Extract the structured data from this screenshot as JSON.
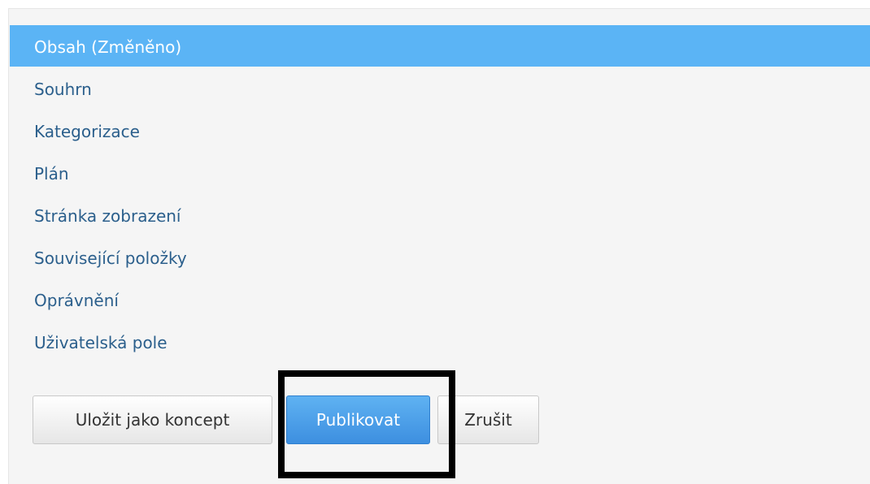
{
  "tabs": [
    {
      "label": "Obsah (Změněno)",
      "active": true
    },
    {
      "label": "Souhrn",
      "active": false
    },
    {
      "label": "Kategorizace",
      "active": false
    },
    {
      "label": "Plán",
      "active": false
    },
    {
      "label": "Stránka zobrazení",
      "active": false
    },
    {
      "label": "Související položky",
      "active": false
    },
    {
      "label": "Oprávnění",
      "active": false
    },
    {
      "label": "Uživatelská pole",
      "active": false
    }
  ],
  "actions": {
    "save_draft_label": "Uložit jako koncept",
    "publish_label": "Publikovat",
    "cancel_label": "Zrušit"
  },
  "colors": {
    "active_tab": "#5bb4f5",
    "link": "#2b5f8c",
    "primary_button": "#4a9fe8",
    "highlight": "#000000"
  }
}
